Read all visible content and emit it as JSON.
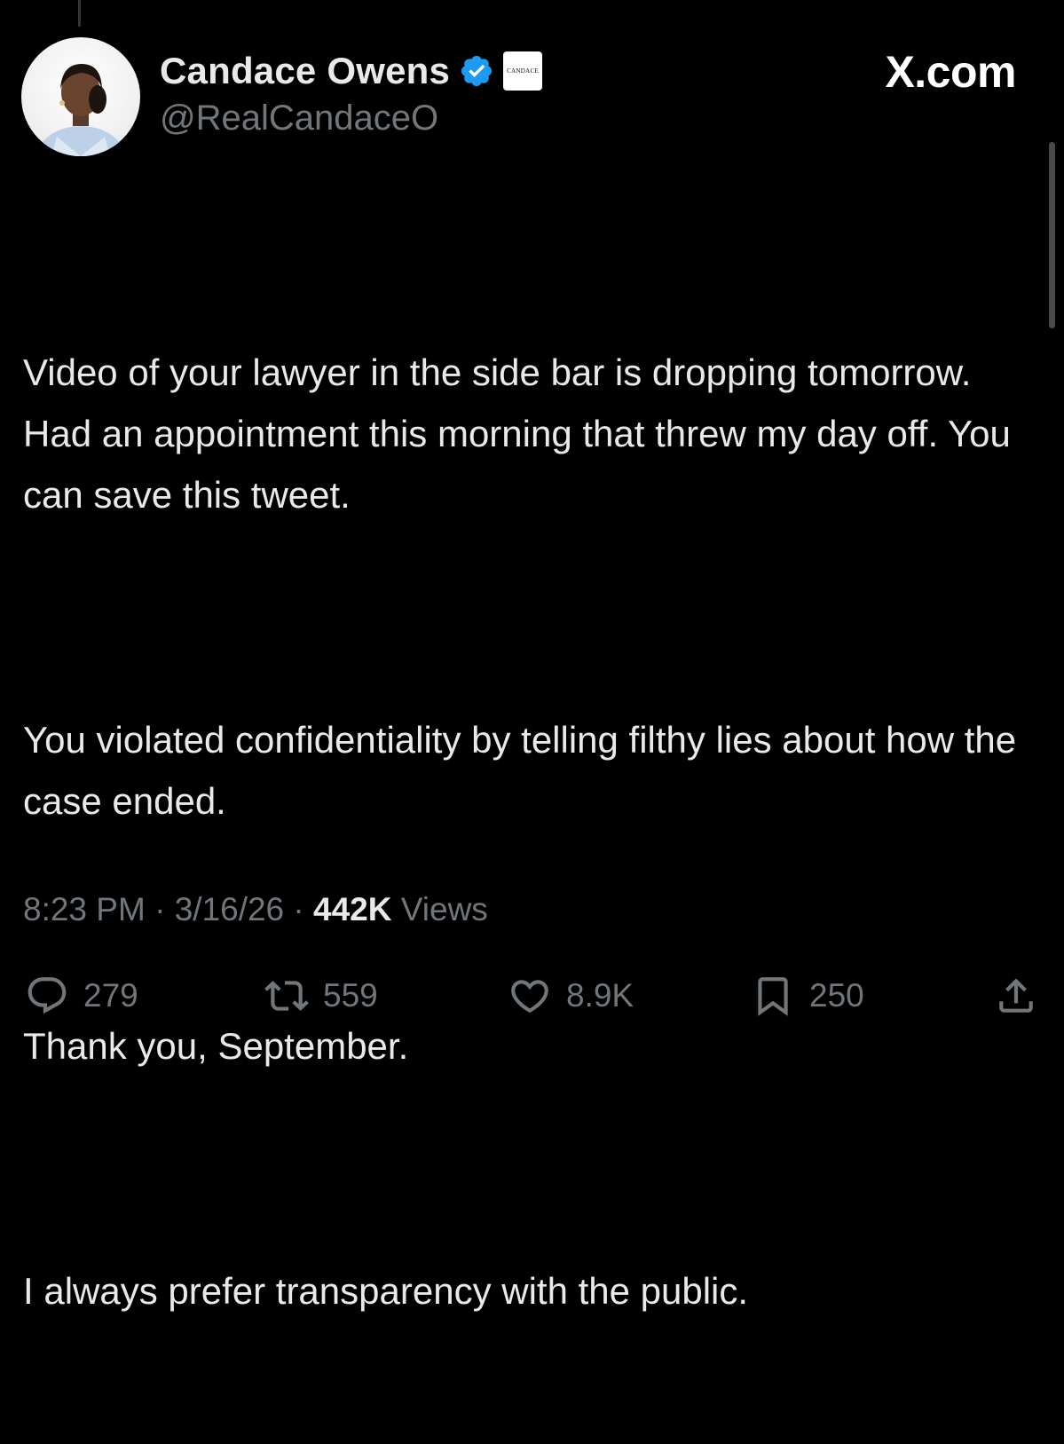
{
  "author": {
    "display_name": "Candace Owens",
    "handle": "@RealCandaceO",
    "affiliate_badge_text": "CANDACE",
    "verified_color": "#1d9bf0"
  },
  "watermark": "X.com",
  "tweet": {
    "paragraphs": [
      "Video of your lawyer in the side bar is dropping tomorrow. Had an appointment this morning that threw my day off. You can save this tweet.",
      "You violated confidentiality by telling filthy lies about how the case ended.",
      "Thank you, September.",
      "I always prefer transparency with the public."
    ]
  },
  "meta": {
    "time": "8:23 PM",
    "separator": " · ",
    "date": "3/16/26",
    "views_count": "442K",
    "views_label": " Views"
  },
  "actions": {
    "reply": {
      "icon": "reply-icon",
      "count": "279"
    },
    "repost": {
      "icon": "repost-icon",
      "count": "559"
    },
    "like": {
      "icon": "heart-icon",
      "count": "8.9K"
    },
    "bookmark": {
      "icon": "bookmark-icon",
      "count": "250"
    },
    "share": {
      "icon": "share-icon"
    }
  },
  "colors": {
    "background": "#000000",
    "primary_text": "#e7e9ea",
    "secondary_text": "#71767b"
  }
}
